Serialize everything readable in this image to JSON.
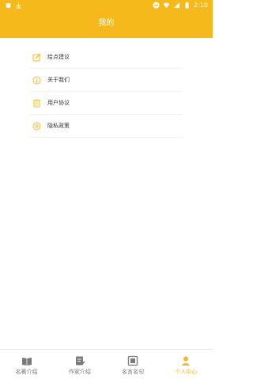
{
  "status": {
    "time": "2:10",
    "left_icons": [
      "bug-icon",
      "download-icon"
    ],
    "right_icons": [
      "dnd-icon",
      "wifi-icon",
      "signal-icon",
      "battery-icon"
    ]
  },
  "header": {
    "title": "我的"
  },
  "menu": {
    "items": [
      {
        "label": "给点建议",
        "icon": "edit-icon"
      },
      {
        "label": "关于我们",
        "icon": "info-icon"
      },
      {
        "label": "用户协议",
        "icon": "document-icon"
      },
      {
        "label": "隐私政策",
        "icon": "privacy-icon"
      }
    ]
  },
  "tabs": [
    {
      "label": "名著介绍",
      "icon": "book-icon",
      "active": false
    },
    {
      "label": "作家介绍",
      "icon": "writer-icon",
      "active": false
    },
    {
      "label": "名言名句",
      "icon": "quote-icon",
      "active": false
    },
    {
      "label": "个人中心",
      "icon": "person-icon",
      "active": true
    }
  ],
  "colors": {
    "accent": "#f6b91b",
    "tab_inactive": "#777777"
  }
}
